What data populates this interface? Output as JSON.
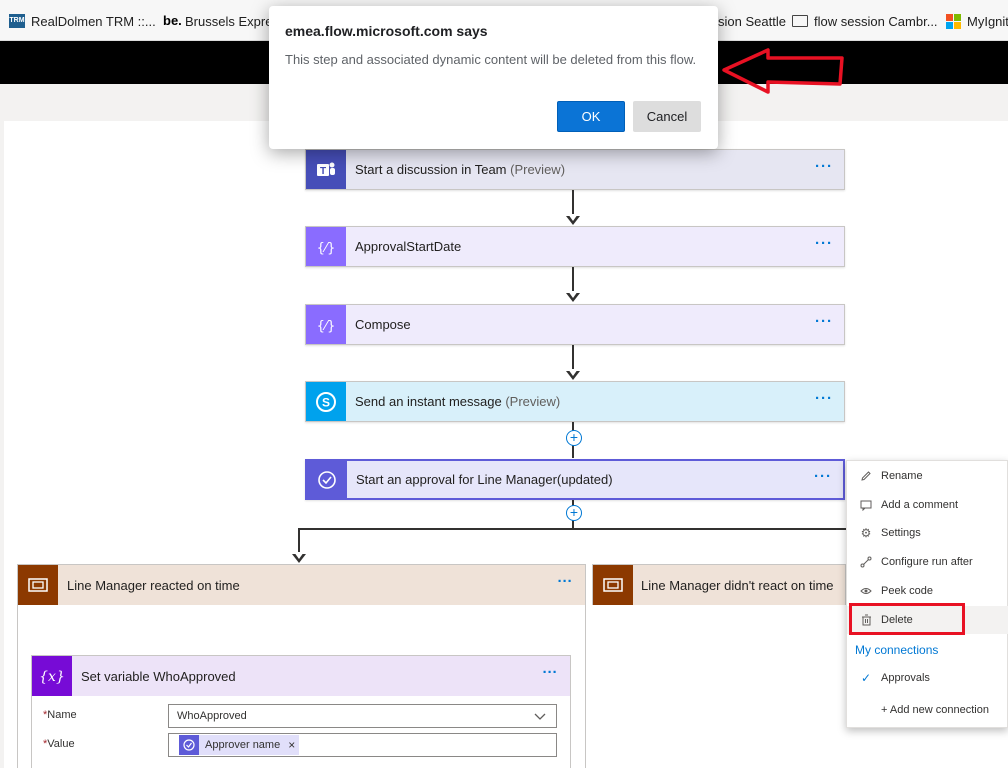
{
  "bookmarks": [
    {
      "label": "RealDolmen TRM ::...",
      "icon": "trm-icon",
      "icon_text": "TRM"
    },
    {
      "label": "Brussels Express",
      "icon": "be-icon",
      "icon_text": "be."
    },
    {
      "label": "sion Seattle",
      "icon": "none"
    },
    {
      "label": "flow session Cambr...",
      "icon": "folder-icon"
    },
    {
      "label": "MyIgnit",
      "icon": "microsoft-icon"
    }
  ],
  "dialog": {
    "title": "emea.flow.microsoft.com says",
    "message": "This step and associated dynamic content will be deleted from this flow.",
    "ok_label": "OK",
    "cancel_label": "Cancel"
  },
  "steps": [
    {
      "title": "Start a discussion in Team",
      "suffix": "(Preview)",
      "icon": "teams-icon",
      "color": "#464eb8",
      "bg": "#e6e6f2"
    },
    {
      "title": "ApprovalStartDate",
      "suffix": "",
      "icon": "variable-icon",
      "color": "#8a6cff",
      "bg": "#efebfc"
    },
    {
      "title": "Compose",
      "suffix": "",
      "icon": "compose-icon",
      "color": "#8a6cff",
      "bg": "#efebfc"
    },
    {
      "title": "Send an instant message",
      "suffix": "(Preview)",
      "icon": "skype-icon",
      "color": "#00a2ed",
      "bg": "#d8f0fa"
    },
    {
      "title": "Start an approval for Line Manager(updated)",
      "suffix": "",
      "icon": "approval-icon",
      "color": "#5e5bd8",
      "bg": "#e6e6fa"
    }
  ],
  "more_label": "···",
  "branches": {
    "left_title": "Line Manager reacted on time",
    "right_title": "Line Manager didn't react on time"
  },
  "set_variable": {
    "title": "Set variable WhoApproved",
    "name_label": "Name",
    "name_value": "WhoApproved",
    "value_label": "Value",
    "value_token": "Approver name",
    "required_marker": "*"
  },
  "context_menu": {
    "items": [
      {
        "label": "Rename",
        "icon": "pencil-icon"
      },
      {
        "label": "Add a comment",
        "icon": "comment-icon"
      },
      {
        "label": "Settings",
        "icon": "gear-icon"
      },
      {
        "label": "Configure run after",
        "icon": "run-after-icon"
      },
      {
        "label": "Peek code",
        "icon": "eye-icon"
      },
      {
        "label": "Delete",
        "icon": "trash-icon"
      }
    ],
    "connections_header": "My connections",
    "connection": "Approvals",
    "add_connection": "+ Add new connection"
  },
  "colors": {
    "accent": "#0078d4",
    "highlight_red": "#e81123",
    "scope_brown": "#8c3900"
  }
}
